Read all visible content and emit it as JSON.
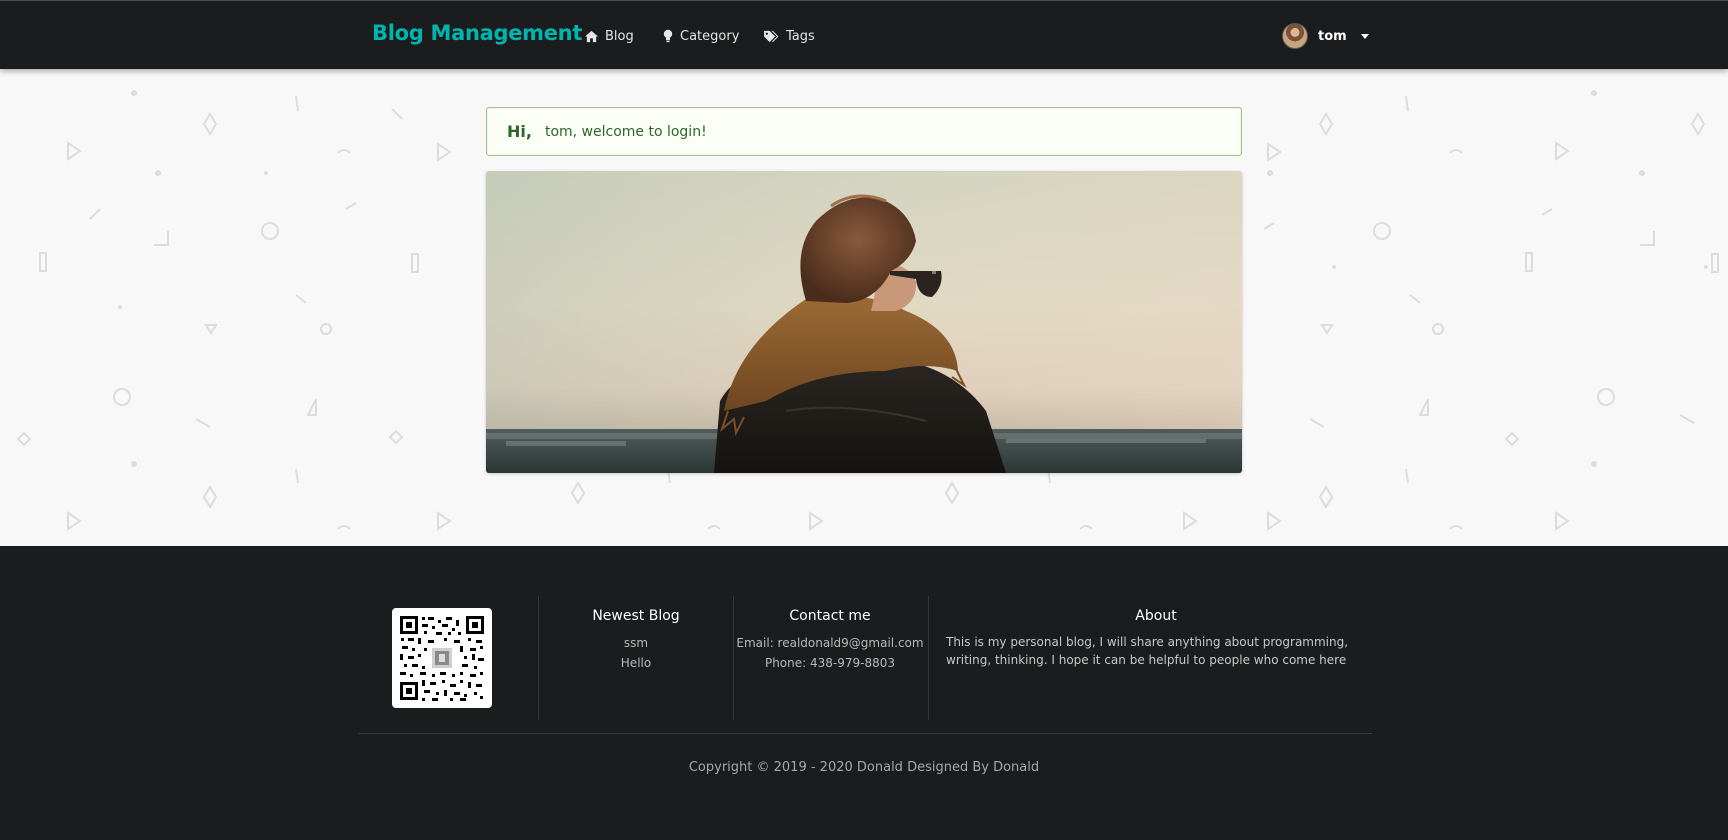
{
  "nav": {
    "brand": "Blog Management",
    "items": [
      {
        "label": "Blog",
        "icon": "home-icon"
      },
      {
        "label": "Category",
        "icon": "lightbulb-icon"
      },
      {
        "label": "Tags",
        "icon": "tags-icon"
      }
    ],
    "user": {
      "name": "tom",
      "avatar_icon": "user-avatar"
    }
  },
  "welcome": {
    "greeting": "Hi,",
    "message": "tom, welcome to login!"
  },
  "hero": {
    "icon": "person-with-scarf-photo"
  },
  "footer": {
    "newest_blog": {
      "title": "Newest Blog",
      "items": [
        "ssm",
        "Hello"
      ]
    },
    "contact": {
      "title": "Contact me",
      "email": "Email: realdonald9@gmail.com",
      "phone": "Phone: 438-979-8803"
    },
    "about": {
      "title": "About",
      "text_line1": "This is my personal blog, I will share anything about programming,",
      "text_line2": "writing, thinking. I hope it can be helpful to people who come here"
    },
    "copyright": "Copyright © 2019 - 2020 Donald Designed By Donald"
  },
  "colors": {
    "brand": "#00b5ad",
    "nav_bg": "#1b1c1d",
    "success_bg": "#fcfff5",
    "success_text": "#2c662d"
  }
}
